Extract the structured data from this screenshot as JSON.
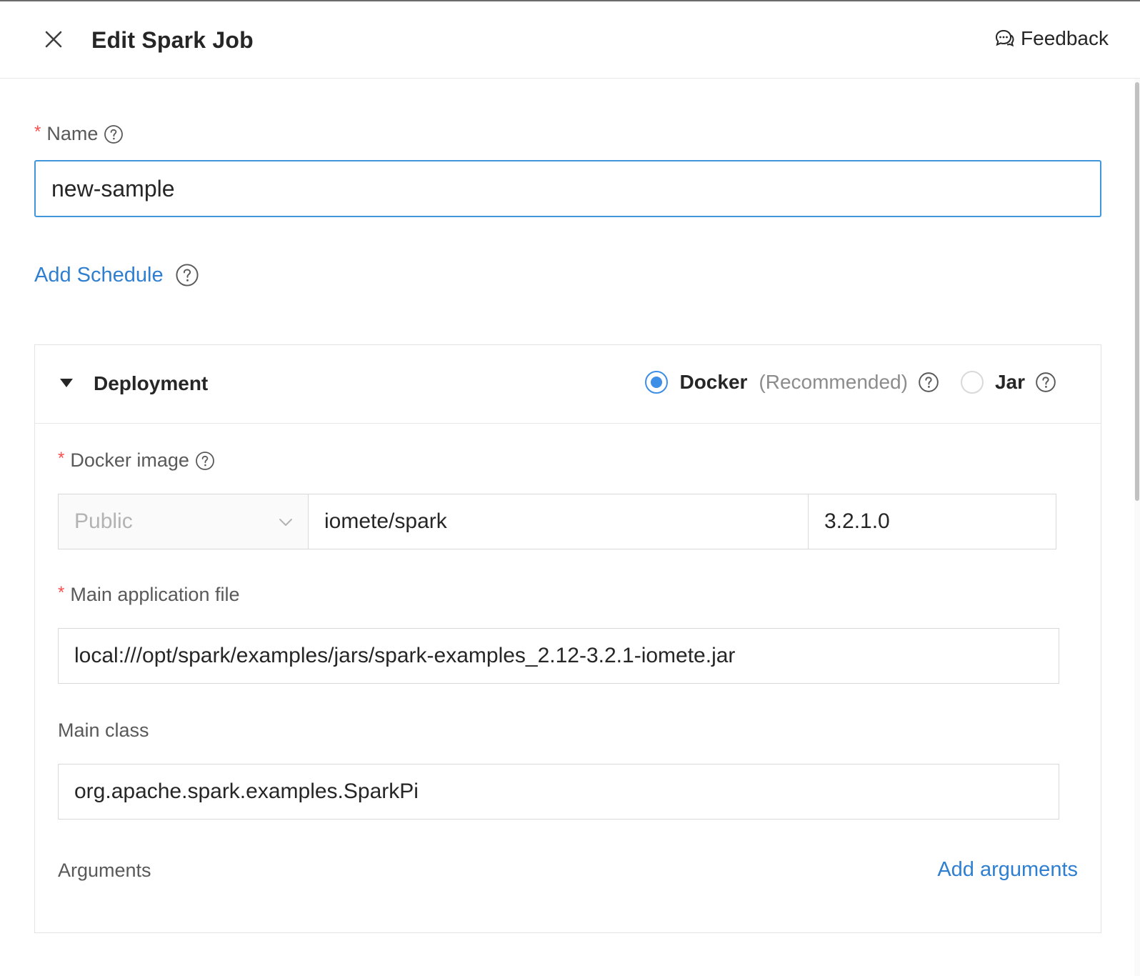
{
  "header": {
    "title": "Edit Spark Job",
    "feedback_label": "Feedback"
  },
  "form": {
    "name": {
      "label": "Name",
      "required_mark": "*",
      "value": "new-sample"
    },
    "add_schedule_label": "Add Schedule",
    "deployment": {
      "title": "Deployment",
      "options": [
        {
          "label": "Docker",
          "hint": "(Recommended)",
          "selected": true
        },
        {
          "label": "Jar",
          "selected": false
        }
      ],
      "docker_image": {
        "label": "Docker image",
        "required_mark": "*",
        "registry": "Public",
        "image": "iomete/spark",
        "tag": "3.2.1.0"
      },
      "main_application_file": {
        "label": "Main application file",
        "required_mark": "*",
        "value": "local:///opt/spark/examples/jars/spark-examples_2.12-3.2.1-iomete.jar"
      },
      "main_class": {
        "label": "Main class",
        "value": "org.apache.spark.examples.SparkPi"
      },
      "arguments": {
        "label": "Arguments",
        "add_label": "Add arguments"
      }
    }
  },
  "colors": {
    "link": "#2f7fd1",
    "focus_border": "#4096d9",
    "radio_selected": "#3d8ee6",
    "required": "#ff4d4f"
  },
  "icons": {
    "close": "close-icon",
    "feedback": "chat-bubbles-icon",
    "help": "question-circle-icon",
    "caret": "caret-down-icon",
    "select_chevron": "chevron-down-icon"
  }
}
